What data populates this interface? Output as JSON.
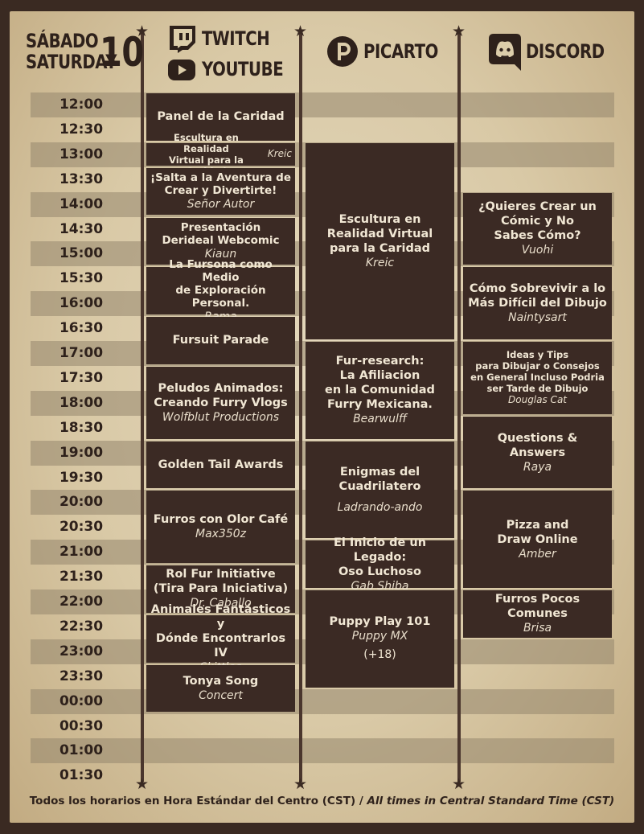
{
  "header": {
    "day_es": "SÁBADO",
    "day_en": "SATURDAY",
    "day_number": "10",
    "col1_line1": "TWITCH",
    "col1_line2": "YOUTUBE",
    "col2": "PICARTO",
    "col3": "DISCORD"
  },
  "times": [
    "12:00",
    "12:30",
    "13:00",
    "13:30",
    "14:00",
    "14:30",
    "15:00",
    "15:30",
    "16:00",
    "16:30",
    "17:00",
    "17:30",
    "18:00",
    "18:30",
    "19:00",
    "19:30",
    "20:00",
    "20:30",
    "21:00",
    "21:30",
    "22:00",
    "22:30",
    "23:00",
    "23:30",
    "00:00",
    "00:30",
    "01:00",
    "01:30"
  ],
  "twitch": [
    {
      "title": "Panel de la Caridad",
      "author": "",
      "start": 0,
      "end": 2,
      "style": ""
    },
    {
      "title": "Escultura en Realidad\nVirtual para la Caridad",
      "author": "Kreic",
      "start": 2,
      "end": 3,
      "style": "small inline"
    },
    {
      "title": "¡Salta a la Aventura de\nCrear y Divertirte!",
      "author": "Señor Autor",
      "start": 3,
      "end": 5,
      "style": "med"
    },
    {
      "title": "Presentación\nDerideal Webcomic",
      "author": "Kiaun",
      "start": 5,
      "end": 7,
      "style": "med"
    },
    {
      "title": "La Fursona como Medio\nde Exploración Personal.",
      "author": "Rama",
      "start": 7,
      "end": 9,
      "style": "med"
    },
    {
      "title": "Fursuit Parade",
      "author": "",
      "start": 9,
      "end": 11,
      "style": ""
    },
    {
      "title": "Peludos Animados:\nCreando Furry Vlogs",
      "author": "Wolfblut Productions",
      "start": 11,
      "end": 14,
      "style": ""
    },
    {
      "title": "Golden Tail Awards",
      "author": "",
      "start": 14,
      "end": 16,
      "style": ""
    },
    {
      "title": "Furros con Olor Café",
      "author": "Max350z",
      "start": 16,
      "end": 19,
      "style": ""
    },
    {
      "title": "Rol Fur Initiative\n(Tira Para Iniciativa)",
      "author": "Dr. Caballo",
      "start": 19,
      "end": 21,
      "style": ""
    },
    {
      "title": "Animales Fantásticos y\nDónde Encontrarlos IV",
      "author": "Skittles",
      "start": 21,
      "end": 23,
      "style": ""
    },
    {
      "title": "Tonya Song",
      "author": "Concert",
      "start": 23,
      "end": 25,
      "style": ""
    }
  ],
  "picarto": [
    {
      "title": "Escultura en\nRealidad Virtual\npara la Caridad",
      "author": "Kreic",
      "start": 2,
      "end": 10,
      "style": ""
    },
    {
      "title": "Fur-research:\nLa Afiliacion\nen la Comunidad\nFurry Mexicana.",
      "author": "Bearwulff",
      "start": 10,
      "end": 14,
      "style": ""
    },
    {
      "title": "Enigmas del\nCuadrilatero",
      "author": "Ladrando-ando",
      "start": 14,
      "end": 18,
      "style": "gap"
    },
    {
      "title": "El Inicio de un Legado:\nOso Luchoso",
      "author": "Gab Shiba",
      "start": 18,
      "end": 20,
      "style": ""
    },
    {
      "title": "Puppy Play 101",
      "author": "Puppy MX",
      "extra": "(+18)",
      "start": 20,
      "end": 24,
      "style": ""
    }
  ],
  "discord": [
    {
      "title": "¿Quieres Crear un\nCómic y No\nSabes Cómo?",
      "author": "Vuohi",
      "start": 4,
      "end": 7,
      "style": ""
    },
    {
      "title": "Cómo Sobrevivir a lo\nMás Difícil del Dibujo",
      "author": "Naintysart",
      "start": 7,
      "end": 10,
      "style": ""
    },
    {
      "title": "Ideas y Tips\npara Dibujar o Consejos\nen General Incluso Podria\nser Tarde de Dibujo",
      "author": "Douglas Cat",
      "start": 10,
      "end": 13,
      "style": "small"
    },
    {
      "title": "Questions &\nAnswers",
      "author": "Raya",
      "start": 13,
      "end": 16,
      "style": ""
    },
    {
      "title": "Pizza and\nDraw Online",
      "author": "Amber",
      "start": 16,
      "end": 20,
      "style": ""
    },
    {
      "title": "Furros Pocos\nComunes",
      "author": "Brisa",
      "start": 20,
      "end": 22,
      "style": ""
    }
  ],
  "footer": {
    "es": "Todos los horarios en Hora Estándar del Centro (CST) / ",
    "en": "All times in Central Standard Time (CST)"
  },
  "colors": {
    "dark": "#3b2a24",
    "paper": "#dccdaa",
    "stripe": "#a89b85",
    "text_light": "#f1e7d4"
  }
}
